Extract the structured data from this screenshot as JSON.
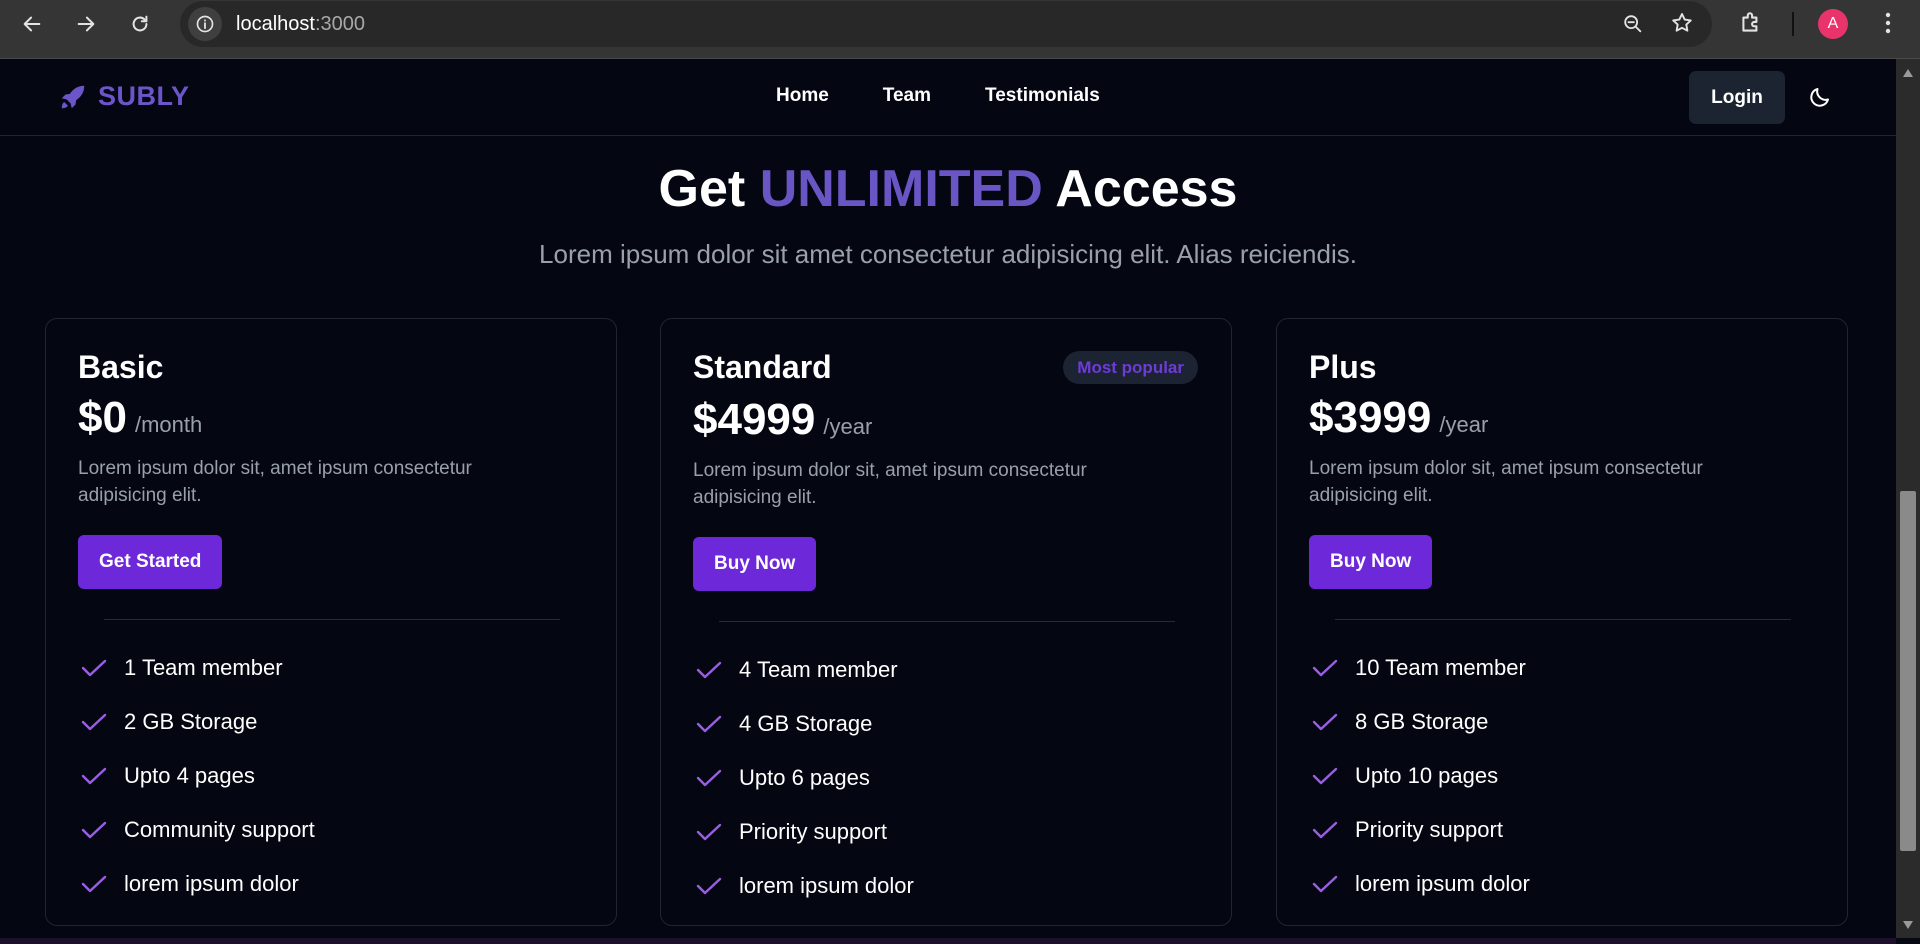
{
  "browser": {
    "url_host": "localhost",
    "url_port": ":3000",
    "avatar_letter": "A"
  },
  "header": {
    "logo_text": "SUBLY",
    "nav": [
      "Home",
      "Team",
      "Testimonials"
    ],
    "login_label": "Login"
  },
  "hero": {
    "title_pre": "Get ",
    "title_accent": "UNLIMITED",
    "title_post": " Access",
    "subtitle": "Lorem ipsum dolor sit amet consectetur adipisicing elit. Alias reiciendis."
  },
  "colors": {
    "accent": "#6a55c5",
    "button": "#6d28d9",
    "check": "#9b5de5",
    "background": "#040712"
  },
  "plans": [
    {
      "name": "Basic",
      "price": "$0",
      "period": "/month",
      "description": "Lorem ipsum dolor sit, amet ipsum consectetur adipisicing elit.",
      "cta": "Get Started",
      "features": [
        "1 Team member",
        "2 GB Storage",
        "Upto 4 pages",
        "Community support",
        "lorem ipsum dolor"
      ]
    },
    {
      "name": "Standard",
      "badge": "Most popular",
      "price": "$4999",
      "period": "/year",
      "description": "Lorem ipsum dolor sit, amet ipsum consectetur adipisicing elit.",
      "cta": "Buy Now",
      "features": [
        "4 Team member",
        "4 GB Storage",
        "Upto 6 pages",
        "Priority support",
        "lorem ipsum dolor"
      ]
    },
    {
      "name": "Plus",
      "price": "$3999",
      "period": "/year",
      "description": "Lorem ipsum dolor sit, amet ipsum consectetur adipisicing elit.",
      "cta": "Buy Now",
      "features": [
        "10 Team member",
        "8 GB Storage",
        "Upto 10 pages",
        "Priority support",
        "lorem ipsum dolor"
      ]
    }
  ]
}
